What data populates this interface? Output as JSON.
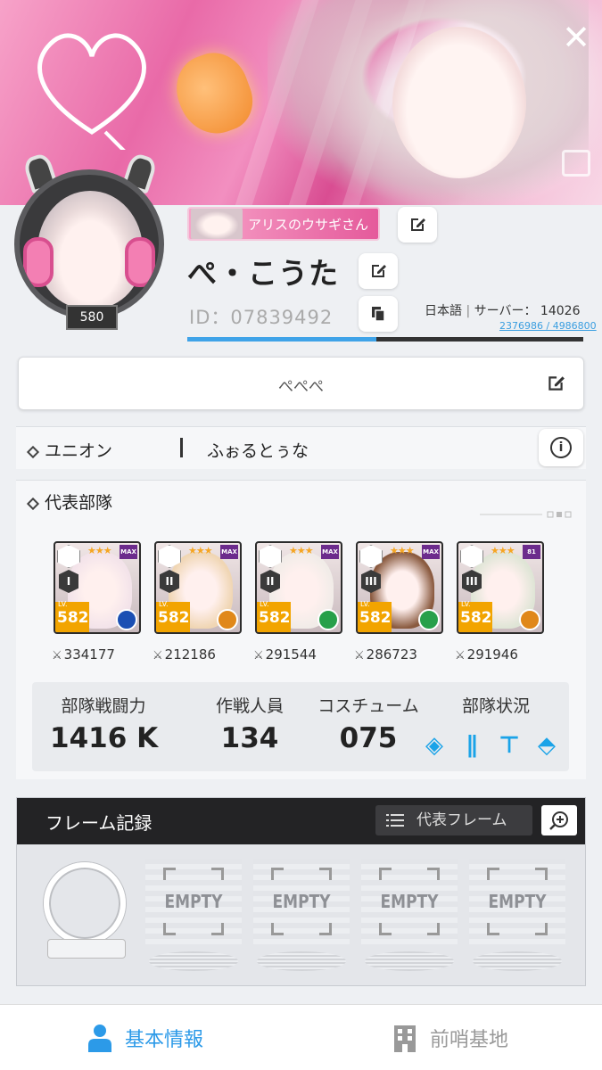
{
  "header": {
    "close_icon": "close-icon",
    "corner_icon": "frame-icon"
  },
  "profile": {
    "title_badge": "アリスのウサギさん",
    "nickname": "ぺ・こうた",
    "user_id": "ID：07839492",
    "language": "日本語",
    "server": "サーバー： 14026",
    "level": "580",
    "exp_text": "2376986 / 4986800",
    "exp_fraction": 0.477,
    "comment": "ぺぺぺ"
  },
  "union": {
    "label": "ユニオン",
    "name": "ふぉるとぅな"
  },
  "squad": {
    "title": "代表部隊",
    "cards": [
      {
        "burst": "I",
        "level": "582",
        "lv_tag": "LV.",
        "badge": "MAX",
        "power": "334177",
        "element_color": "#1b4fb3",
        "portrait_bg": "#f3e3ea"
      },
      {
        "burst": "II",
        "level": "582",
        "lv_tag": "LV.",
        "badge": "MAX",
        "power": "212186",
        "element_color": "#e0881a",
        "portrait_bg": "#f0d6b4"
      },
      {
        "burst": "II",
        "level": "582",
        "lv_tag": "LV.",
        "badge": "MAX",
        "power": "291544",
        "element_color": "#27a04a",
        "portrait_bg": "#f1ece8"
      },
      {
        "burst": "III",
        "level": "582",
        "lv_tag": "LV.",
        "badge": "MAX",
        "power": "286723",
        "element_color": "#27a04a",
        "portrait_bg": "#8a5a3f"
      },
      {
        "burst": "III",
        "level": "582",
        "lv_tag": "LV.",
        "badge": "81",
        "power": "291946",
        "element_color": "#e0881a",
        "portrait_bg": "#dfe5d6"
      }
    ],
    "stats": {
      "combat_power_label": "部隊戦闘力",
      "combat_power": "1416 K",
      "members_label": "作戦人員",
      "members": "134",
      "costume_label": "コスチューム",
      "costume": "075",
      "status_label": "部隊状況"
    }
  },
  "frame_record": {
    "title": "フレーム記録",
    "representative_label": "代表フレーム",
    "slots": [
      "EMPTY",
      "EMPTY",
      "EMPTY",
      "EMPTY"
    ]
  },
  "tabs": [
    {
      "label": "基本情報",
      "icon": "person-icon",
      "active": true
    },
    {
      "label": "前哨基地",
      "icon": "building-icon",
      "active": false
    }
  ],
  "colors": {
    "accent": "#2c9ae8",
    "exp_bar": "#3fa3e8",
    "banner_pink": "#e96aa8"
  }
}
